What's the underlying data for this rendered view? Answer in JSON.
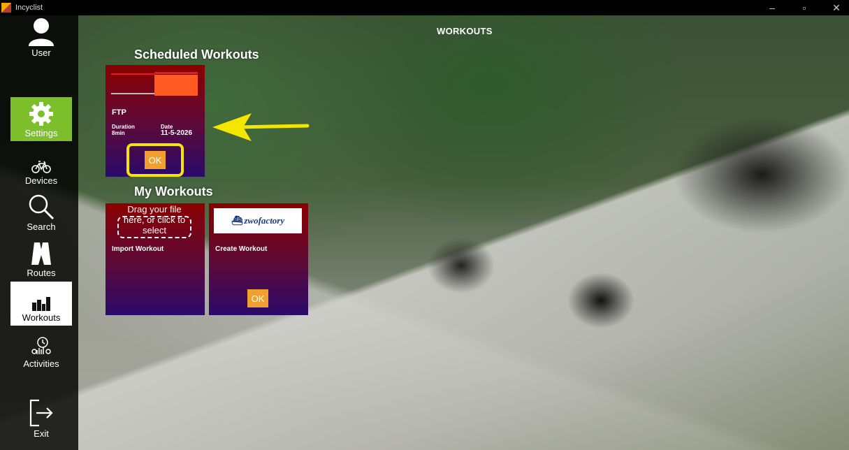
{
  "window": {
    "title": "Incyclist",
    "controls": {
      "minimize": "–",
      "maximize": "▫",
      "close": "✕"
    }
  },
  "sidebar": {
    "items": [
      {
        "label": "User",
        "icon": "user-icon"
      },
      {
        "label": "Settings",
        "icon": "gear-icon",
        "active_color": "#7dbf2a"
      },
      {
        "label": "Devices",
        "icon": "bicycle-icon"
      },
      {
        "label": "Search",
        "icon": "search-icon"
      },
      {
        "label": "Routes",
        "icon": "routes-icon"
      },
      {
        "label": "Workouts",
        "icon": "workouts-icon",
        "selected": true
      },
      {
        "label": "Activities",
        "icon": "activities-icon"
      },
      {
        "label": "Exit",
        "icon": "exit-icon"
      }
    ]
  },
  "main": {
    "heading": "WORKOUTS",
    "scheduled": {
      "title": "Scheduled Workouts",
      "card": {
        "name": "FTP",
        "duration_label": "Duration",
        "duration_value": "8min",
        "date_label": "Date",
        "date_value": "11-5-2026",
        "ok_label": "OK"
      }
    },
    "my_workouts": {
      "title": "My Workouts",
      "import_card": {
        "dropzone_text": "Drag your file here, or click to select",
        "title": "Import Workout"
      },
      "create_card": {
        "logo_text": "zwofactory",
        "title": "Create Workout",
        "ok_label": "OK"
      }
    }
  },
  "colors": {
    "card_gradient_top": "#8b0000",
    "card_gradient_bottom": "#2a0a6a",
    "ok_button": "#f0a030",
    "highlight": "#f5e600",
    "settings_active": "#7dbf2a"
  }
}
